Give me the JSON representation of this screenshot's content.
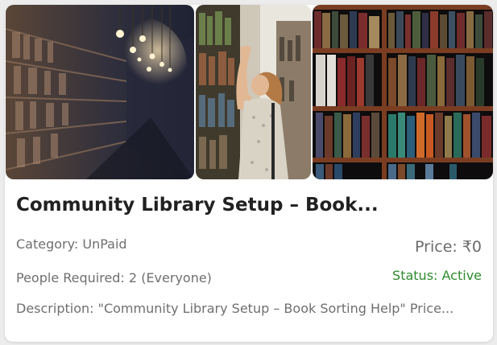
{
  "images": [
    {
      "icon": "library-aisle-photo"
    },
    {
      "icon": "woman-browsing-shelves-photo"
    },
    {
      "icon": "bookshelf-closeup-photo"
    }
  ],
  "card": {
    "title": "Community Library Setup – Book...",
    "category": "Category: UnPaid",
    "price": "Price: ₹0",
    "people": "People Required: 2 (Everyone)",
    "status": "Status: Active",
    "description": "Description: \"Community Library Setup – Book Sorting Help\" Price..."
  },
  "colors": {
    "status": "#2e8b2e",
    "title": "#212121",
    "muted": "#6f6f6f"
  }
}
